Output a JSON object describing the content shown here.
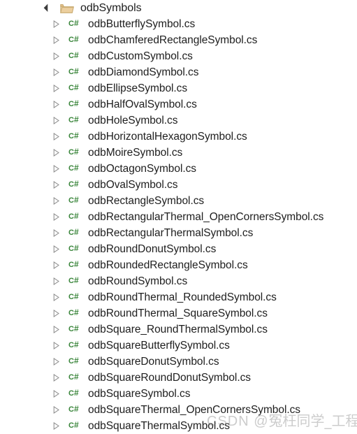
{
  "tree": {
    "root": {
      "label": "odbSymbols",
      "icon": "folder-icon",
      "expander": "triangle-expanded-icon",
      "expanded": true
    },
    "child_icon": "csharp-file-icon",
    "child_icon_text": "C#",
    "child_expander": "triangle-collapsed-icon",
    "items": [
      {
        "label": "odbButterflySymbol.cs"
      },
      {
        "label": "odbChamferedRectangleSymbol.cs"
      },
      {
        "label": "odbCustomSymbol.cs"
      },
      {
        "label": "odbDiamondSymbol.cs"
      },
      {
        "label": "odbEllipseSymbol.cs"
      },
      {
        "label": "odbHalfOvalSymbol.cs"
      },
      {
        "label": "odbHoleSymbol.cs"
      },
      {
        "label": "odbHorizontalHexagonSymbol.cs"
      },
      {
        "label": "odbMoireSymbol.cs"
      },
      {
        "label": "odbOctagonSymbol.cs"
      },
      {
        "label": "odbOvalSymbol.cs"
      },
      {
        "label": "odbRectangleSymbol.cs"
      },
      {
        "label": "odbRectangularThermal_OpenCornersSymbol.cs"
      },
      {
        "label": "odbRectangularThermalSymbol.cs"
      },
      {
        "label": "odbRoundDonutSymbol.cs"
      },
      {
        "label": "odbRoundedRectangleSymbol.cs"
      },
      {
        "label": "odbRoundSymbol.cs"
      },
      {
        "label": "odbRoundThermal_RoundedSymbol.cs"
      },
      {
        "label": "odbRoundThermal_SquareSymbol.cs"
      },
      {
        "label": "odbSquare_RoundThermalSymbol.cs"
      },
      {
        "label": "odbSquareButterflySymbol.cs"
      },
      {
        "label": "odbSquareDonutSymbol.cs"
      },
      {
        "label": "odbSquareRoundDonutSymbol.cs"
      },
      {
        "label": "odbSquareSymbol.cs"
      },
      {
        "label": "odbSquareThermal_OpenCornersSymbol.cs"
      },
      {
        "label": "odbSquareThermalSymbol.cs"
      }
    ]
  },
  "watermark": {
    "prefix": "CSDN @",
    "author": "冤枉同学_工程师"
  },
  "colors": {
    "background": "#ffffff",
    "text": "#1e1e1e",
    "csharp_icon_green": "#39853a",
    "folder_tan": "#e3c08d",
    "expander_outline": "#7a7a7a",
    "expander_filled": "#3c3c3c"
  }
}
